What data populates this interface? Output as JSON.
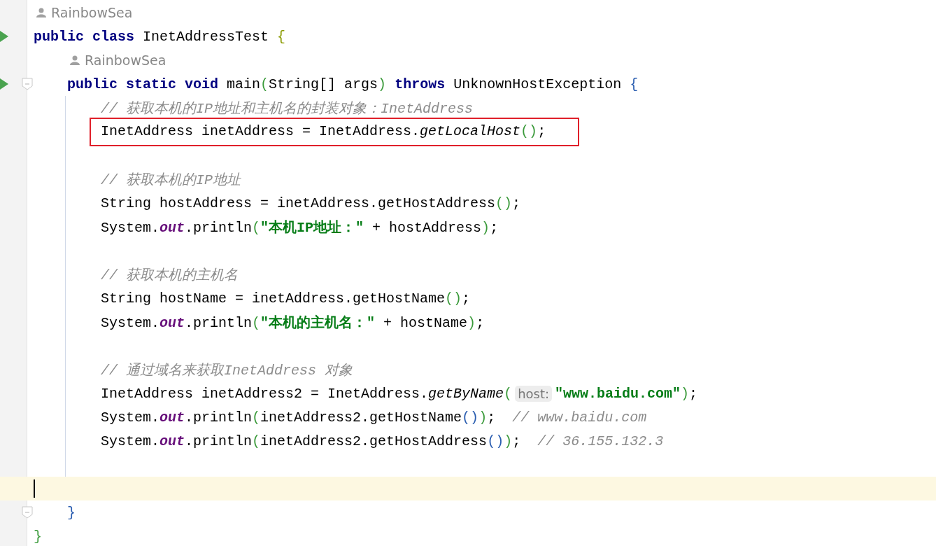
{
  "editor": {
    "lines": [
      {
        "kind": "author",
        "text": "RainbowSea"
      },
      {
        "kind": "code",
        "runnable": true,
        "tokens": [
          {
            "kind": "kw",
            "t": "public class "
          },
          {
            "kind": "plain",
            "t": "InetAddressTest "
          },
          {
            "kind": "brace-olive",
            "t": "{"
          }
        ],
        "children": [
          {
            "kind": "author",
            "text": "RainbowSea"
          },
          {
            "kind": "code",
            "runnable": true,
            "fold": true,
            "tokens": [
              {
                "kind": "kw",
                "t": "public static void "
              },
              {
                "kind": "plain",
                "t": "main"
              },
              {
                "kind": "paren-green",
                "t": "("
              },
              {
                "kind": "plain",
                "t": "String[] args"
              },
              {
                "kind": "paren-green",
                "t": ")"
              },
              {
                "kind": "kw",
                "t": " throws "
              },
              {
                "kind": "plain",
                "t": "UnknownHostException "
              },
              {
                "kind": "paren-blue",
                "t": "{"
              }
            ],
            "children": [
              {
                "kind": "code",
                "tokens": [
                  {
                    "kind": "comment",
                    "t": "// 获取本机的IP地址和主机名的封装对象：InetAddress"
                  }
                ]
              },
              {
                "kind": "code",
                "boxed": true,
                "tokens": [
                  {
                    "kind": "plain",
                    "t": "InetAddress inetAddress = InetAddress."
                  },
                  {
                    "kind": "italic",
                    "t": "getLocalHost"
                  },
                  {
                    "kind": "paren-green",
                    "t": "()"
                  },
                  {
                    "kind": "plain",
                    "t": ";"
                  }
                ]
              },
              {
                "kind": "blank"
              },
              {
                "kind": "code",
                "tokens": [
                  {
                    "kind": "comment",
                    "t": "// 获取本机的IP地址"
                  }
                ]
              },
              {
                "kind": "code",
                "tokens": [
                  {
                    "kind": "plain",
                    "t": "String hostAddress = inetAddress.getHostAddress"
                  },
                  {
                    "kind": "paren-green",
                    "t": "()"
                  },
                  {
                    "kind": "plain",
                    "t": ";"
                  }
                ]
              },
              {
                "kind": "code",
                "tokens": [
                  {
                    "kind": "plain",
                    "t": "System."
                  },
                  {
                    "kind": "field",
                    "t": "out"
                  },
                  {
                    "kind": "plain",
                    "t": ".println"
                  },
                  {
                    "kind": "paren-green",
                    "t": "("
                  },
                  {
                    "kind": "string",
                    "t": "\"本机IP地址：\""
                  },
                  {
                    "kind": "plain",
                    "t": " + hostAddress"
                  },
                  {
                    "kind": "paren-green",
                    "t": ")"
                  },
                  {
                    "kind": "plain",
                    "t": ";"
                  }
                ]
              },
              {
                "kind": "blank"
              },
              {
                "kind": "code",
                "tokens": [
                  {
                    "kind": "comment",
                    "t": "// 获取本机的主机名"
                  }
                ]
              },
              {
                "kind": "code",
                "tokens": [
                  {
                    "kind": "plain",
                    "t": "String hostName = inetAddress.getHostName"
                  },
                  {
                    "kind": "paren-green",
                    "t": "()"
                  },
                  {
                    "kind": "plain",
                    "t": ";"
                  }
                ]
              },
              {
                "kind": "code",
                "tokens": [
                  {
                    "kind": "plain",
                    "t": "System."
                  },
                  {
                    "kind": "field",
                    "t": "out"
                  },
                  {
                    "kind": "plain",
                    "t": ".println"
                  },
                  {
                    "kind": "paren-green",
                    "t": "("
                  },
                  {
                    "kind": "string",
                    "t": "\"本机的主机名：\""
                  },
                  {
                    "kind": "plain",
                    "t": " + hostName"
                  },
                  {
                    "kind": "paren-green",
                    "t": ")"
                  },
                  {
                    "kind": "plain",
                    "t": ";"
                  }
                ]
              },
              {
                "kind": "blank"
              },
              {
                "kind": "code",
                "tokens": [
                  {
                    "kind": "comment",
                    "t": "// 通过域名来获取InetAddress 对象"
                  }
                ]
              },
              {
                "kind": "code",
                "tokens": [
                  {
                    "kind": "plain",
                    "t": "InetAddress inetAddress2 = InetAddress."
                  },
                  {
                    "kind": "italic",
                    "t": "getByName"
                  },
                  {
                    "kind": "paren-green",
                    "t": "("
                  },
                  {
                    "kind": "hint",
                    "t": "host:"
                  },
                  {
                    "kind": "string",
                    "t": "\"www.baidu.com\""
                  },
                  {
                    "kind": "paren-green",
                    "t": ")"
                  },
                  {
                    "kind": "plain",
                    "t": ";"
                  }
                ]
              },
              {
                "kind": "code",
                "tokens": [
                  {
                    "kind": "plain",
                    "t": "System."
                  },
                  {
                    "kind": "field",
                    "t": "out"
                  },
                  {
                    "kind": "plain",
                    "t": ".println"
                  },
                  {
                    "kind": "paren-green",
                    "t": "("
                  },
                  {
                    "kind": "plain",
                    "t": "inetAddress2.getHostName"
                  },
                  {
                    "kind": "paren-blue",
                    "t": "()"
                  },
                  {
                    "kind": "paren-green",
                    "t": ")"
                  },
                  {
                    "kind": "plain",
                    "t": ";  "
                  },
                  {
                    "kind": "comment",
                    "t": "// www.baidu.com"
                  }
                ]
              },
              {
                "kind": "code",
                "tokens": [
                  {
                    "kind": "plain",
                    "t": "System."
                  },
                  {
                    "kind": "field",
                    "t": "out"
                  },
                  {
                    "kind": "plain",
                    "t": ".println"
                  },
                  {
                    "kind": "paren-green",
                    "t": "("
                  },
                  {
                    "kind": "plain",
                    "t": "inetAddress2.getHostAddress"
                  },
                  {
                    "kind": "paren-blue",
                    "t": "()"
                  },
                  {
                    "kind": "paren-green",
                    "t": ")"
                  },
                  {
                    "kind": "plain",
                    "t": ";  "
                  },
                  {
                    "kind": "comment",
                    "t": "// 36.155.132.3"
                  }
                ]
              },
              {
                "kind": "blank"
              },
              {
                "kind": "blank",
                "current": true
              }
            ]
          },
          {
            "kind": "code",
            "fold": true,
            "tokens": [
              {
                "kind": "paren-blue",
                "t": "}"
              }
            ]
          }
        ]
      },
      {
        "kind": "code",
        "tokens": [
          {
            "kind": "paren-green",
            "t": "}"
          }
        ]
      }
    ]
  }
}
